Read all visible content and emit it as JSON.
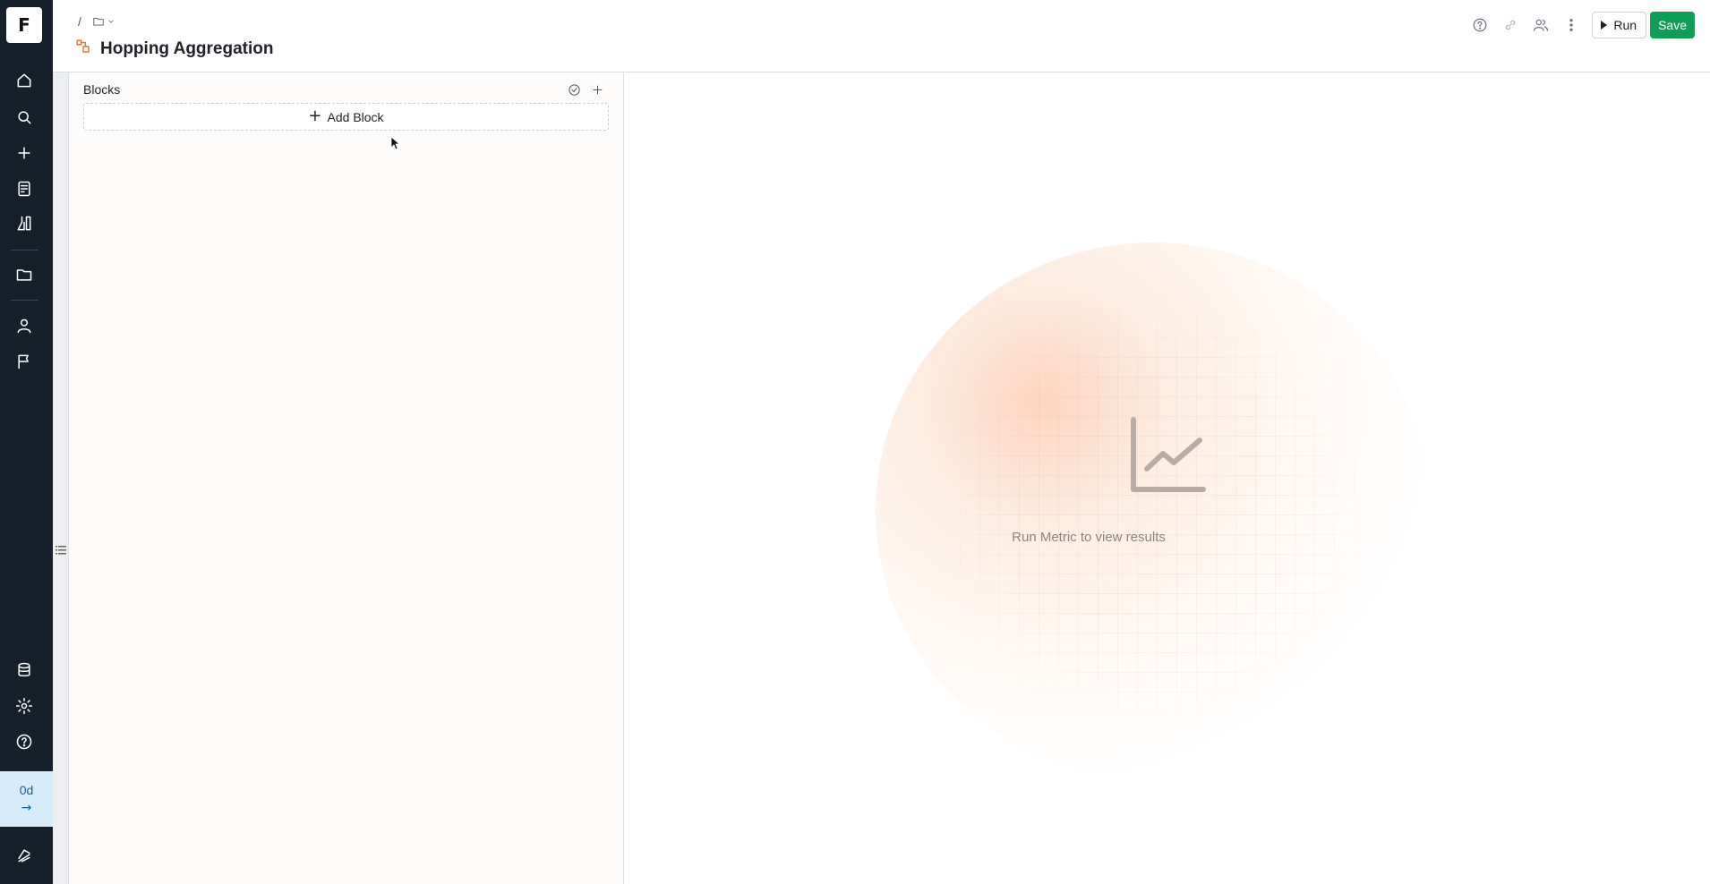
{
  "app": {
    "logo_letter": "F",
    "credit": {
      "value": "0d",
      "arrow": "→"
    }
  },
  "rail": {
    "top_icons": [
      "home-icon",
      "search-icon",
      "plus-icon",
      "notebook-icon",
      "flask-icon"
    ],
    "mid_icons": [
      "folder-icon"
    ],
    "lower_icons": [
      "user-icon",
      "flag-icon"
    ],
    "bottom_icons": [
      "database-icon",
      "gear-icon",
      "help-icon"
    ],
    "footer_icon": "brand-icon"
  },
  "header": {
    "breadcrumb_sep": "/",
    "title": "Hopping Aggregation",
    "actions": {
      "run_label": "Run",
      "save_label": "Save"
    },
    "colors": {
      "save_bg": "#0f9d58",
      "title_icon": "#e07a3b"
    }
  },
  "panel": {
    "title": "Blocks",
    "add_block_label": "Add Block"
  },
  "results": {
    "empty_message": "Run Metric to view results"
  }
}
